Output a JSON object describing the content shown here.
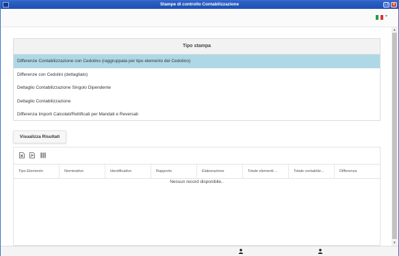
{
  "window": {
    "title": "Stampe di controllo Contabilizzazione",
    "minimize_symbol": "❐",
    "close_symbol": "✕"
  },
  "appbar": {
    "language_icon": "italian-flag-icon",
    "language_caret": "▾"
  },
  "report_panel": {
    "header": "Tipo stampa",
    "options": [
      "Differenze Contabilizzazione con Cedolino (raggruppata per tipo elemento del Cedolino)",
      "Differenze con Cedolini (dettagliato)",
      "Dettaglio Contabilizzazione Singolo Dipendente",
      "Dettaglio Contabilizzazione",
      "Differenza Importi Calcolati/Rettificati per Mandati e Reversali"
    ],
    "selected_index": 0,
    "selected_color": "#aed8e6"
  },
  "actions": {
    "show_results": "Visualizza Risultati"
  },
  "grid": {
    "toolbar_icons": [
      "excel-export-icon",
      "pdf-export-icon",
      "columns-icon"
    ],
    "columns": [
      "Tipo Elemento",
      "Nominativo",
      "Identificativo",
      "Rapporto",
      "Elaborazione",
      "Totale elementi ...",
      "Totale contabiliz...",
      "Differenza"
    ],
    "empty_message": "Nessun record disponibile.."
  },
  "statusbar": {
    "icons": [
      "user-icon",
      "user-icon"
    ]
  },
  "colors": {
    "titlebar": "#1d4fb3",
    "selection": "#aed8e6"
  }
}
